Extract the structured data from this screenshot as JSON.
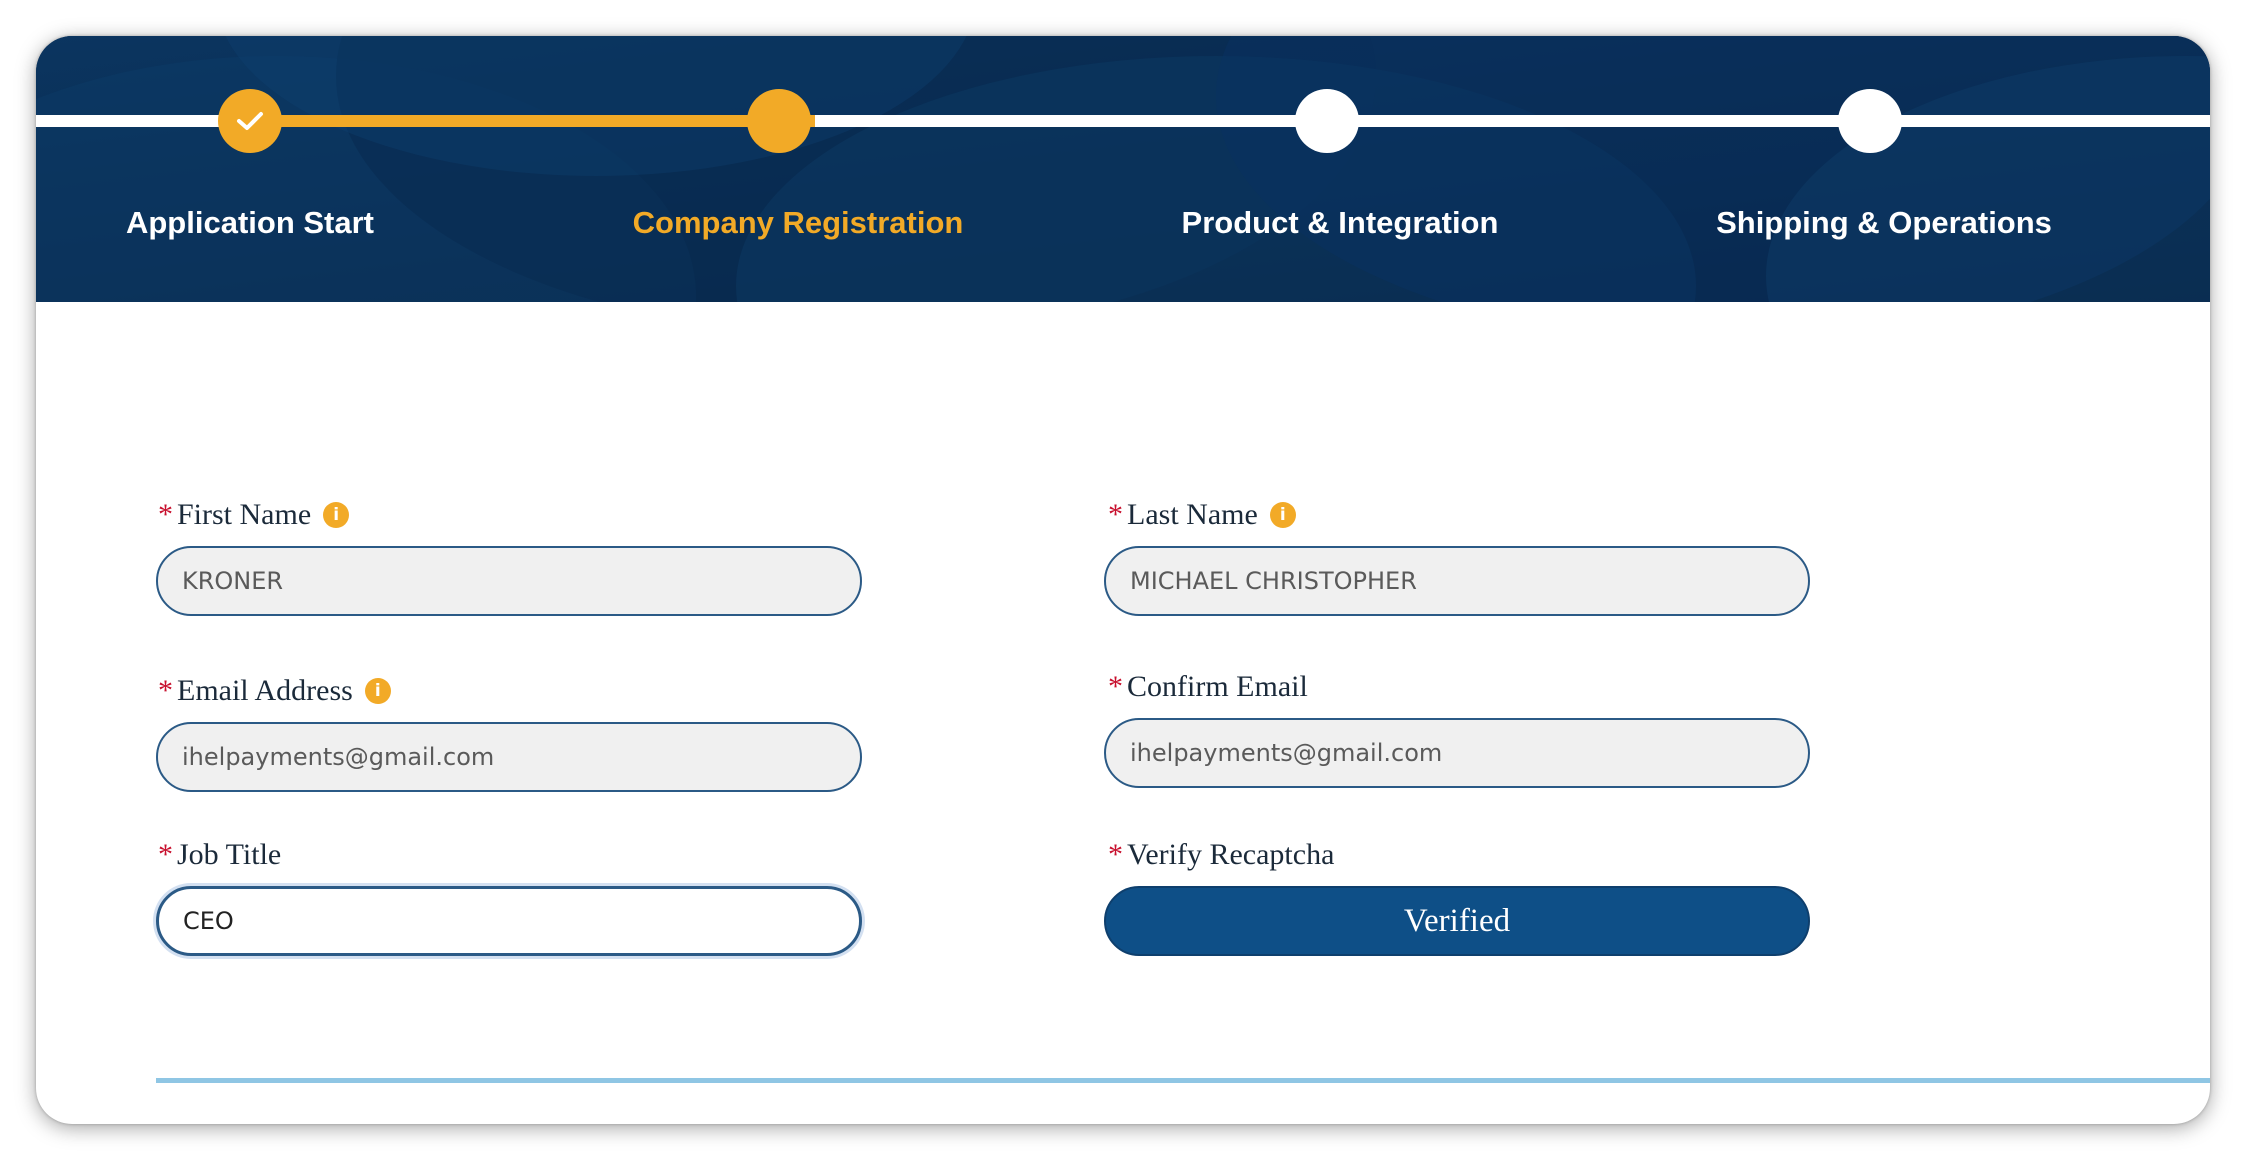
{
  "steps": [
    {
      "label": "Application Start",
      "state": "done"
    },
    {
      "label": "Company Registration",
      "state": "active"
    },
    {
      "label": "Product & Integration",
      "state": "pending"
    },
    {
      "label": "Shipping & Operations",
      "state": "pending"
    }
  ],
  "colors": {
    "banner": "#0a2a4e",
    "accent": "#f2aa27",
    "required": "#c8102e",
    "button": "#0e4f87",
    "divider": "#8fc6e4"
  },
  "form": {
    "required_mark": "*",
    "first_name": {
      "label": "First Name",
      "value": "KRONER",
      "info_icon": "i"
    },
    "last_name": {
      "label": "Last Name",
      "value": "MICHAEL CHRISTOPHER",
      "info_icon": "i"
    },
    "email": {
      "label": "Email Address",
      "value": "ihelpayments@gmail.com",
      "info_icon": "i"
    },
    "confirm_email": {
      "label": "Confirm Email",
      "value": "ihelpayments@gmail.com"
    },
    "job_title": {
      "label": "Job Title",
      "value": "CEO"
    },
    "recaptcha": {
      "label": "Verify Recaptcha",
      "button_label": "Verified"
    }
  }
}
